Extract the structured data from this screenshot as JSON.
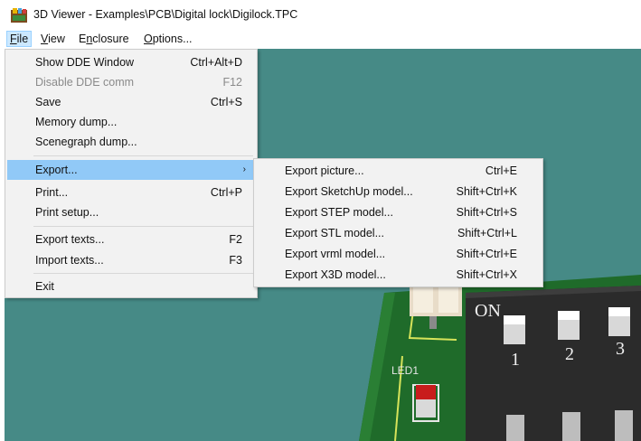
{
  "window": {
    "title": "3D Viewer - Examples\\PCB\\Digital lock\\Digilock.TPC"
  },
  "menubar": [
    {
      "u": "F",
      "rest": "ile"
    },
    {
      "u": "V",
      "rest": "iew"
    },
    {
      "pre": "E",
      "u": "n",
      "rest": "closure"
    },
    {
      "u": "O",
      "rest": "ptions..."
    }
  ],
  "file_menu": [
    {
      "label": "Show DDE Window",
      "shortcut": "Ctrl+Alt+D"
    },
    {
      "label": "Disable DDE comm",
      "shortcut": "F12"
    },
    {
      "label": "Save",
      "shortcut": "Ctrl+S"
    },
    {
      "label": "Memory dump...",
      "shortcut": ""
    },
    {
      "label": "Scenegraph dump...",
      "shortcut": ""
    },
    {
      "label": "Export...",
      "shortcut": ""
    },
    {
      "label": "Print...",
      "shortcut": "Ctrl+P"
    },
    {
      "label": "Print setup...",
      "shortcut": ""
    },
    {
      "label": "Export texts...",
      "shortcut": "F2"
    },
    {
      "label": "Import texts...",
      "shortcut": "F3"
    },
    {
      "label": "Exit",
      "shortcut": ""
    }
  ],
  "export_submenu": [
    {
      "label": "Export picture...",
      "shortcut": "Ctrl+E"
    },
    {
      "label": "Export SketchUp model...",
      "shortcut": "Shift+Ctrl+K"
    },
    {
      "label": "Export STEP model...",
      "shortcut": "Shift+Ctrl+S"
    },
    {
      "label": "Export STL model...",
      "shortcut": "Shift+Ctrl+L"
    },
    {
      "label": "Export vrml model...",
      "shortcut": "Shift+Ctrl+E"
    },
    {
      "label": "Export X3D model...",
      "shortcut": "Shift+Ctrl+X"
    }
  ],
  "pcb": {
    "switch_label": "ON",
    "switch_numbers": [
      "1",
      "2",
      "3"
    ],
    "led_label": "LED1"
  },
  "colors": {
    "viewport_bg": "#468a86",
    "pcb_green": "#1f6b2a",
    "menu_highlight": "#91c9f7"
  },
  "icons": {
    "app": "3d-viewer-app-icon",
    "submenu_arrow": "chevron-right-icon"
  }
}
